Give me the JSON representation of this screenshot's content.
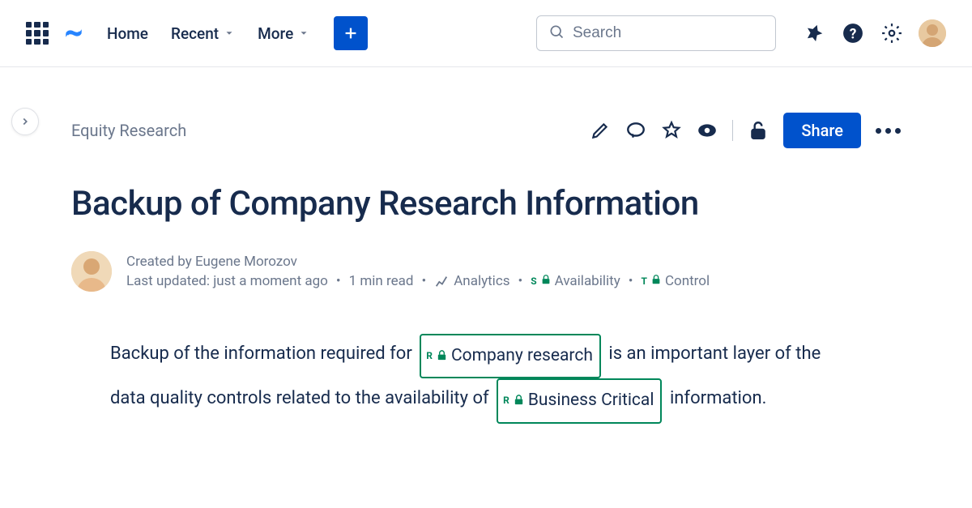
{
  "nav": {
    "home": "Home",
    "recent": "Recent",
    "more": "More"
  },
  "search": {
    "placeholder": "Search"
  },
  "breadcrumb": "Equity Research",
  "share_label": "Share",
  "page_title": "Backup of Company Research Information",
  "byline": {
    "author_line": "Created by Eugene Morozov",
    "updated": "Last updated: just a moment ago",
    "read_time": "1 min read",
    "analytics": "Analytics",
    "availability": "Availability",
    "control": "Control",
    "avail_letter": "S",
    "control_letter": "T"
  },
  "body": {
    "pre1": "Backup of the information required for ",
    "tag1": "Company research",
    "mid1": " is an important layer of the data quality controls related to the availability of ",
    "tag2": "Business Critical",
    "post": " information.",
    "tag_letter": "R"
  }
}
